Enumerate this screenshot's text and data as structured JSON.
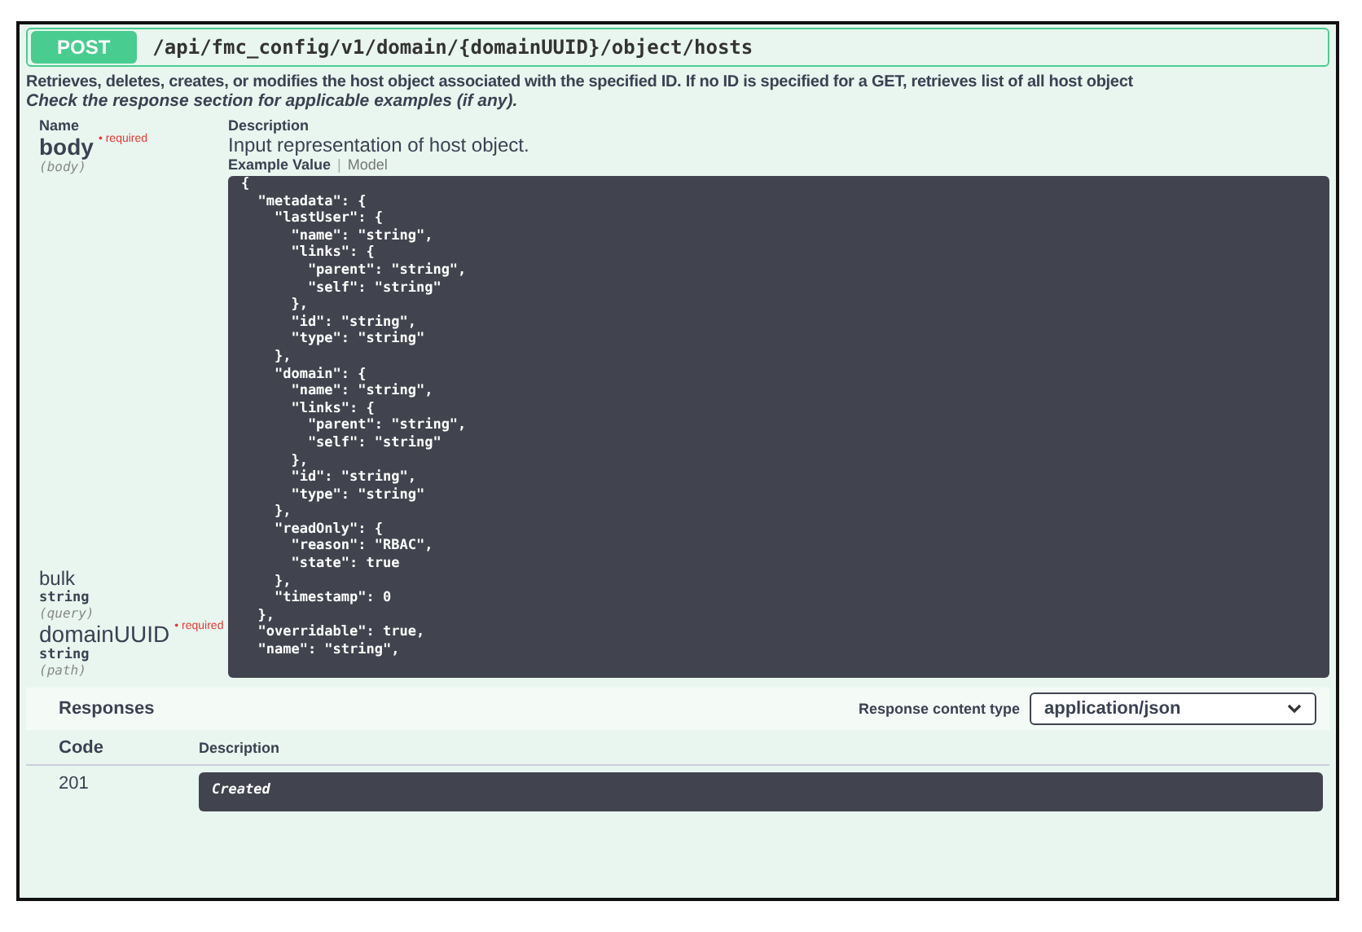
{
  "operation": {
    "method": "POST",
    "path": "/api/fmc_config/v1/domain/{domainUUID}/object/hosts"
  },
  "description": "Retrieves, deletes, creates, or modifies the host object associated with the specified ID. If no ID is specified for a GET, retrieves list of all host object",
  "note": "Check the response section for applicable examples (if any).",
  "parameters_header": {
    "name": "Name",
    "description": "Description"
  },
  "parameters": [
    {
      "kind": "body",
      "name": "body",
      "required": true,
      "required_label": "• required",
      "location": "(body)",
      "description": "Input representation of host object.",
      "tabs": [
        {
          "label": "Example Value",
          "selected": true
        },
        {
          "label": "Model",
          "selected": false
        }
      ],
      "tab_separator": "|",
      "example_lines": [
        "{",
        "  \"metadata\": {",
        "    \"lastUser\": {",
        "      \"name\": \"string\",",
        "      \"links\": {",
        "        \"parent\": \"string\",",
        "        \"self\": \"string\"",
        "      },",
        "      \"id\": \"string\",",
        "      \"type\": \"string\"",
        "    },",
        "    \"domain\": {",
        "      \"name\": \"string\",",
        "      \"links\": {",
        "        \"parent\": \"string\",",
        "        \"self\": \"string\"",
        "      },",
        "      \"id\": \"string\",",
        "      \"type\": \"string\"",
        "    },",
        "    \"readOnly\": {",
        "      \"reason\": \"RBAC\",",
        "      \"state\": true",
        "    },",
        "    \"timestamp\": 0",
        "  },",
        "  \"overridable\": true,",
        "  \"name\": \"string\","
      ]
    },
    {
      "kind": "plain",
      "name": "bulk",
      "required": false,
      "type": "string",
      "location": "(query)"
    },
    {
      "kind": "plain",
      "name": "domainUUID",
      "required": true,
      "required_label": "• required",
      "type": "string",
      "location": "(path)"
    }
  ],
  "responses": {
    "title": "Responses",
    "content_type_label": "Response content type",
    "content_type": "application/json",
    "columns": [
      "Code",
      "Description"
    ],
    "rows": [
      {
        "code": "201",
        "description": "Created"
      }
    ]
  }
}
